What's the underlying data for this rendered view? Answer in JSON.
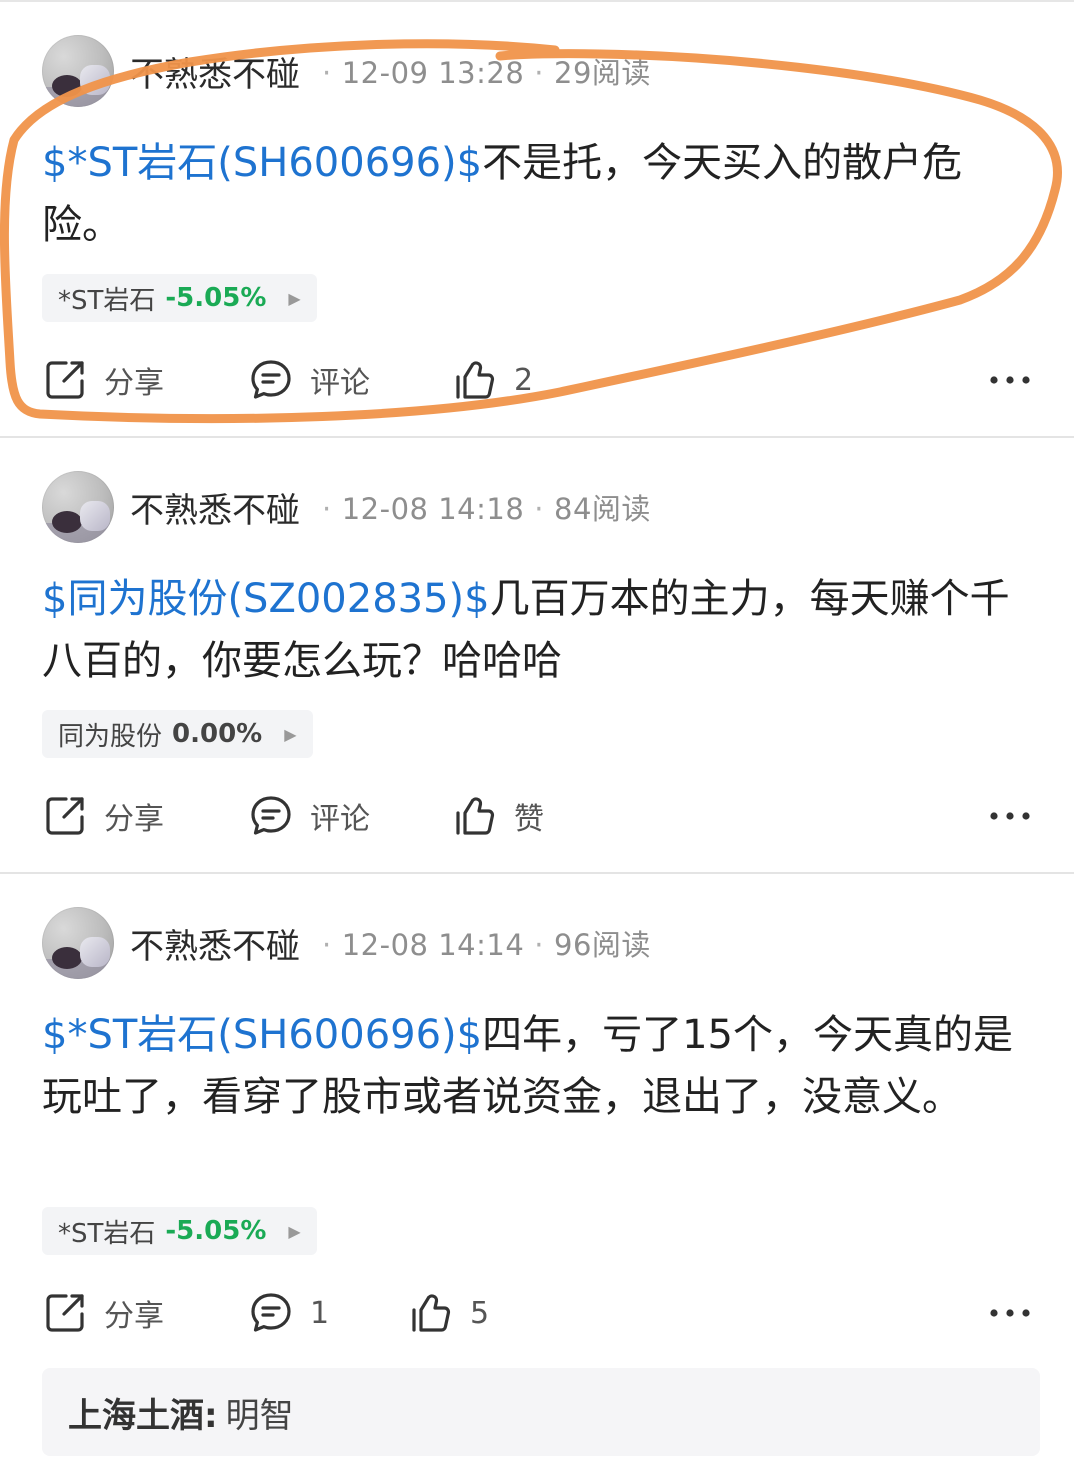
{
  "posts": [
    {
      "username": "不熟悉不碰",
      "date": "12-09 13:28",
      "reads": "29阅读",
      "tag": "$*ST岩石(SH600696)$",
      "text": "不是托，今天买入的散户危险。",
      "stock": {
        "name": "*ST岩石",
        "change": "-5.05%",
        "color": "#1aaa55"
      },
      "share_label": "分享",
      "comment_label": "评论",
      "like_label": "2"
    },
    {
      "username": "不熟悉不碰",
      "date": "12-08 14:18",
      "reads": "84阅读",
      "tag": "$同为股份(SZ002835)$",
      "text": "几百万本的主力，每天赚个千八百的，你要怎么玩？哈哈哈",
      "stock": {
        "name": "同为股份",
        "change": "0.00%",
        "color": "#444444"
      },
      "share_label": "分享",
      "comment_label": "评论",
      "like_label": "赞"
    },
    {
      "username": "不熟悉不碰",
      "date": "12-08 14:14",
      "reads": "96阅读",
      "tag": "$*ST岩石(SH600696)$",
      "text": "四年，亏了15个，今天真的是玩吐了，看穿了股市或者说资金，退出了，没意义。",
      "stock": {
        "name": "*ST岩石",
        "change": "-5.05%",
        "color": "#1aaa55"
      },
      "share_label": "分享",
      "comment_label": "1",
      "like_label": "5"
    }
  ],
  "comment_preview": {
    "user": "上海土酒:",
    "text": "明智"
  },
  "colors": {
    "tag_blue": "#1e73d0",
    "annotation_orange": "#f0944a"
  },
  "icons": [
    "share-icon",
    "comment-icon",
    "like-icon",
    "more-icon",
    "chevron-right-icon"
  ]
}
